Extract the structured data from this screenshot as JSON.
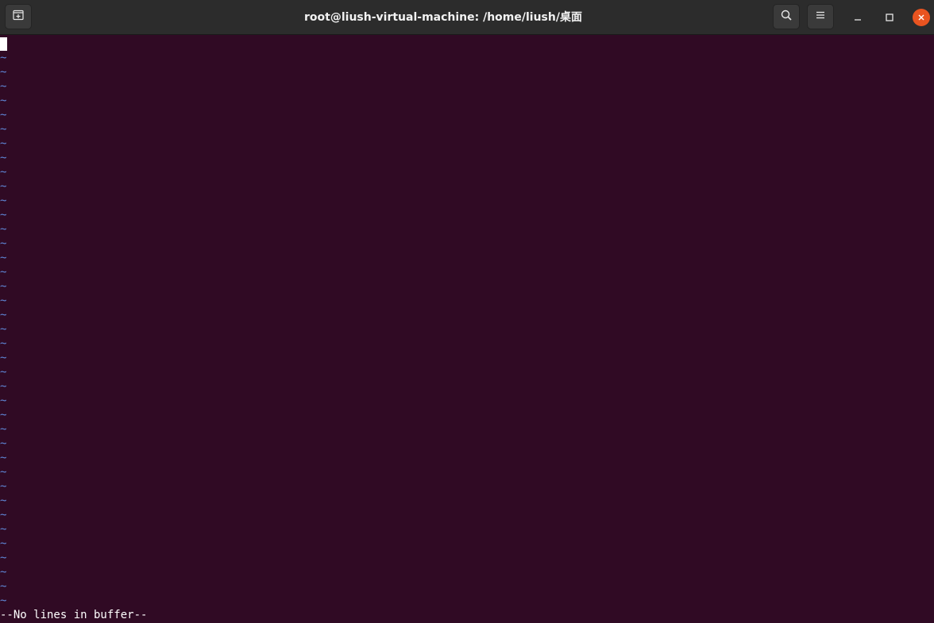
{
  "window": {
    "title": "root@liush-virtual-machine: /home/liush/桌面"
  },
  "icons": {
    "new_tab": "new-tab-icon",
    "search": "search-icon",
    "menu": "hamburger-menu-icon",
    "minimize": "minimize-icon",
    "maximize": "maximize-icon",
    "close": "close-icon"
  },
  "colors": {
    "terminal_bg": "#300a24",
    "tilde": "#5f87d7",
    "close_button": "#e95420",
    "titlebar": "#2c2c2c"
  },
  "editor": {
    "tilde_char": "~",
    "tilde_count": 39,
    "status_message": "--No lines in buffer--"
  }
}
